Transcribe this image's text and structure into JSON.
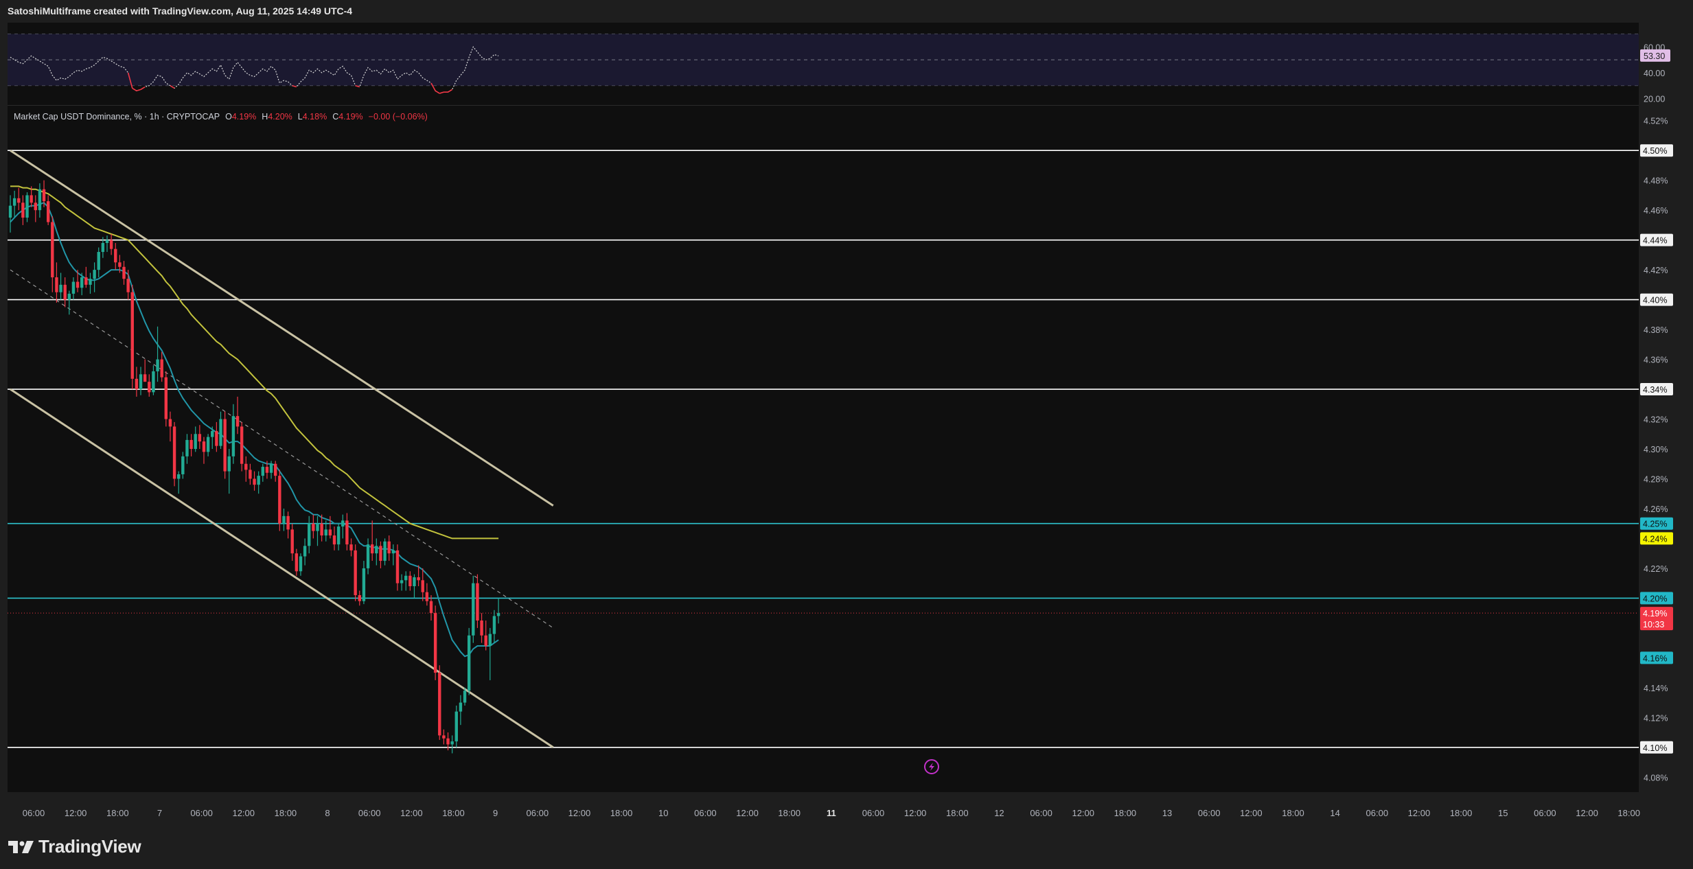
{
  "header": {
    "title": "SatoshiMultiframe created with TradingView.com, Aug 11, 2025 14:49 UTC-4"
  },
  "colors": {
    "background": "#1e1e1e",
    "panel": "#0f0f0f",
    "up": "#22ab94",
    "down": "#f23645",
    "ema_fast": "#2196a8",
    "ema_slow": "#c3c33d",
    "channel": "#c9c2a4",
    "level_white": "#ffffff",
    "level_cyan": "#2ec4cf",
    "rsi_band": "#1b1930"
  },
  "legend": {
    "symbol": "Market Cap USDT Dominance, % · 1h · CRYPTOCAP",
    "o_label": "O",
    "o_value": "4.19%",
    "h_label": "H",
    "h_value": "4.20%",
    "l_label": "L",
    "l_value": "4.18%",
    "c_label": "C",
    "c_value": "4.19%",
    "change": "−0.00 (−0.06%)"
  },
  "rsi_panel": {
    "ticks": [
      "60.00",
      "40.00",
      "20.00"
    ],
    "tick_values": [
      60,
      40,
      20
    ],
    "upper_band": 70,
    "lower_band": 30,
    "current_label": "53.30",
    "current_value": 53.3
  },
  "price_axis": {
    "ticks": [
      "4.52%",
      "4.48%",
      "4.46%",
      "4.42%",
      "4.38%",
      "4.36%",
      "4.32%",
      "4.30%",
      "4.28%",
      "4.26%",
      "4.22%",
      "4.14%",
      "4.12%",
      "4.08%"
    ],
    "tick_values": [
      4.52,
      4.48,
      4.46,
      4.42,
      4.38,
      4.36,
      4.32,
      4.3,
      4.28,
      4.26,
      4.22,
      4.14,
      4.12,
      4.08
    ]
  },
  "levels": [
    {
      "label": "4.50%",
      "value": 4.5,
      "kind": "white"
    },
    {
      "label": "4.44%",
      "value": 4.44,
      "kind": "white"
    },
    {
      "label": "4.40%",
      "value": 4.4,
      "kind": "white"
    },
    {
      "label": "4.34%",
      "value": 4.34,
      "kind": "white"
    },
    {
      "label": "4.25%",
      "value": 4.25,
      "kind": "cyan"
    },
    {
      "label": "4.20%",
      "value": 4.2,
      "kind": "cyan"
    },
    {
      "label": "4.10%",
      "value": 4.1,
      "kind": "white"
    }
  ],
  "badges": {
    "ema_slow": {
      "label": "4.24%",
      "value": 4.24
    },
    "price": {
      "label": "4.19%",
      "value": 4.19,
      "countdown": "10:33"
    },
    "ema_fast": {
      "label": "4.16%",
      "value": 4.16
    }
  },
  "time_axis": {
    "labels": [
      "06:00",
      "12:00",
      "18:00",
      "7",
      "06:00",
      "12:00",
      "18:00",
      "8",
      "06:00",
      "12:00",
      "18:00",
      "9",
      "06:00",
      "12:00",
      "18:00",
      "10",
      "06:00",
      "12:00",
      "18:00",
      "11",
      "06:00",
      "12:00",
      "18:00",
      "12",
      "06:00",
      "12:00",
      "18:00",
      "13",
      "06:00",
      "12:00",
      "18:00",
      "14",
      "06:00",
      "12:00",
      "18:00",
      "15",
      "06:00",
      "12:00",
      "18:00"
    ],
    "bold": [
      "11"
    ]
  },
  "chart_data": {
    "type": "candlestick",
    "symbol": "Market Cap USDT Dominance, %",
    "interval": "1h",
    "exchange": "CRYPTOCAP",
    "unit": "%",
    "ylim": [
      4.07,
      4.53
    ],
    "x_start": "Aug 6 03:00",
    "x_end": "Aug 15 21:00",
    "candles": [
      [
        4.455,
        4.47,
        4.445,
        4.463
      ],
      [
        4.463,
        4.473,
        4.455,
        4.468
      ],
      [
        4.468,
        4.475,
        4.46,
        4.465
      ],
      [
        4.465,
        4.47,
        4.45,
        4.455
      ],
      [
        4.455,
        4.472,
        4.452,
        4.47
      ],
      [
        4.47,
        4.476,
        4.462,
        4.465
      ],
      [
        4.465,
        4.47,
        4.452,
        4.46
      ],
      [
        4.46,
        4.478,
        4.455,
        4.474
      ],
      [
        4.474,
        4.48,
        4.462,
        4.466
      ],
      [
        4.466,
        4.47,
        4.45,
        4.452
      ],
      [
        4.452,
        4.456,
        4.405,
        4.415
      ],
      [
        4.415,
        4.425,
        4.398,
        4.405
      ],
      [
        4.405,
        4.418,
        4.4,
        4.41
      ],
      [
        4.41,
        4.415,
        4.395,
        4.4
      ],
      [
        4.4,
        4.406,
        4.39,
        4.404
      ],
      [
        4.404,
        4.415,
        4.4,
        4.412
      ],
      [
        4.412,
        4.42,
        4.405,
        4.408
      ],
      [
        4.408,
        4.418,
        4.403,
        4.415
      ],
      [
        4.415,
        4.422,
        4.408,
        4.41
      ],
      [
        4.41,
        4.418,
        4.404,
        4.414
      ],
      [
        4.414,
        4.425,
        4.405,
        4.42
      ],
      [
        4.42,
        4.435,
        4.415,
        4.432
      ],
      [
        4.432,
        4.442,
        4.428,
        4.438
      ],
      [
        4.438,
        4.443,
        4.432,
        4.44
      ],
      [
        4.44,
        4.444,
        4.43,
        4.434
      ],
      [
        4.434,
        4.438,
        4.42,
        4.425
      ],
      [
        4.425,
        4.43,
        4.418,
        4.422
      ],
      [
        4.422,
        4.426,
        4.41,
        4.414
      ],
      [
        4.414,
        4.42,
        4.4,
        4.405
      ],
      [
        4.405,
        4.41,
        4.34,
        4.347
      ],
      [
        4.347,
        4.355,
        4.335,
        4.34
      ],
      [
        4.34,
        4.355,
        4.336,
        4.35
      ],
      [
        4.35,
        4.36,
        4.345,
        4.345
      ],
      [
        4.345,
        4.35,
        4.335,
        4.338
      ],
      [
        4.338,
        4.356,
        4.336,
        4.352
      ],
      [
        4.352,
        4.382,
        4.345,
        4.36
      ],
      [
        4.36,
        4.365,
        4.345,
        4.348
      ],
      [
        4.348,
        4.352,
        4.315,
        4.32
      ],
      [
        4.32,
        4.325,
        4.305,
        4.315
      ],
      [
        4.315,
        4.318,
        4.275,
        4.28
      ],
      [
        4.28,
        4.285,
        4.27,
        4.283
      ],
      [
        4.283,
        4.298,
        4.28,
        4.295
      ],
      [
        4.295,
        4.31,
        4.29,
        4.306
      ],
      [
        4.306,
        4.31,
        4.295,
        4.3
      ],
      [
        4.3,
        4.315,
        4.298,
        4.31
      ],
      [
        4.31,
        4.316,
        4.3,
        4.305
      ],
      [
        4.305,
        4.308,
        4.29,
        4.298
      ],
      [
        4.298,
        4.31,
        4.295,
        4.308
      ],
      [
        4.308,
        4.315,
        4.3,
        4.312
      ],
      [
        4.312,
        4.318,
        4.298,
        4.302
      ],
      [
        4.302,
        4.325,
        4.3,
        4.32
      ],
      [
        4.32,
        4.325,
        4.28,
        4.285
      ],
      [
        4.285,
        4.3,
        4.27,
        4.295
      ],
      [
        4.295,
        4.33,
        4.29,
        4.322
      ],
      [
        4.322,
        4.335,
        4.31,
        4.315
      ],
      [
        4.315,
        4.318,
        4.285,
        4.29
      ],
      [
        4.29,
        4.295,
        4.278,
        4.286
      ],
      [
        4.286,
        4.29,
        4.276,
        4.28
      ],
      [
        4.28,
        4.285,
        4.272,
        4.276
      ],
      [
        4.276,
        4.285,
        4.27,
        4.282
      ],
      [
        4.282,
        4.29,
        4.278,
        4.288
      ],
      [
        4.288,
        4.292,
        4.28,
        4.284
      ],
      [
        4.284,
        4.292,
        4.28,
        4.29
      ],
      [
        4.29,
        4.292,
        4.278,
        4.282
      ],
      [
        4.282,
        4.286,
        4.245,
        4.25
      ],
      [
        4.25,
        4.26,
        4.245,
        4.255
      ],
      [
        4.255,
        4.258,
        4.24,
        4.246
      ],
      [
        4.246,
        4.25,
        4.225,
        4.23
      ],
      [
        4.23,
        4.233,
        4.215,
        4.218
      ],
      [
        4.218,
        4.23,
        4.215,
        4.228
      ],
      [
        4.228,
        4.24,
        4.222,
        4.235
      ],
      [
        4.235,
        4.255,
        4.23,
        4.25
      ],
      [
        4.25,
        4.256,
        4.24,
        4.245
      ],
      [
        4.245,
        4.255,
        4.235,
        4.25
      ],
      [
        4.25,
        4.256,
        4.238,
        4.242
      ],
      [
        4.242,
        4.252,
        4.238,
        4.246
      ],
      [
        4.246,
        4.255,
        4.24,
        4.242
      ],
      [
        4.242,
        4.248,
        4.232,
        4.236
      ],
      [
        4.236,
        4.25,
        4.232,
        4.248
      ],
      [
        4.248,
        4.256,
        4.24,
        4.252
      ],
      [
        4.252,
        4.257,
        4.232,
        4.236
      ],
      [
        4.236,
        4.24,
        4.228,
        4.232
      ],
      [
        4.232,
        4.236,
        4.198,
        4.202
      ],
      [
        4.202,
        4.205,
        4.195,
        4.198
      ],
      [
        4.198,
        4.225,
        4.196,
        4.22
      ],
      [
        4.22,
        4.24,
        4.216,
        4.236
      ],
      [
        4.236,
        4.252,
        4.225,
        4.23
      ],
      [
        4.23,
        4.24,
        4.222,
        4.235
      ],
      [
        4.235,
        4.238,
        4.22,
        4.225
      ],
      [
        4.225,
        4.24,
        4.222,
        4.238
      ],
      [
        4.238,
        4.242,
        4.225,
        4.23
      ],
      [
        4.23,
        4.236,
        4.222,
        4.232
      ],
      [
        4.232,
        4.236,
        4.205,
        4.21
      ],
      [
        4.21,
        4.216,
        4.205,
        4.212
      ],
      [
        4.212,
        4.218,
        4.205,
        4.215
      ],
      [
        4.215,
        4.218,
        4.205,
        4.208
      ],
      [
        4.208,
        4.216,
        4.2,
        4.214
      ],
      [
        4.214,
        4.222,
        4.208,
        4.212
      ],
      [
        4.212,
        4.22,
        4.198,
        4.204
      ],
      [
        4.204,
        4.21,
        4.195,
        4.198
      ],
      [
        4.198,
        4.202,
        4.185,
        4.19
      ],
      [
        4.19,
        4.195,
        4.145,
        4.15
      ],
      [
        4.15,
        4.155,
        4.105,
        4.108
      ],
      [
        4.108,
        4.112,
        4.102,
        4.106
      ],
      [
        4.106,
        4.11,
        4.098,
        4.102
      ],
      [
        4.102,
        4.108,
        4.096,
        4.104
      ],
      [
        4.104,
        4.128,
        4.1,
        4.124
      ],
      [
        4.124,
        4.135,
        4.115,
        4.13
      ],
      [
        4.13,
        4.14,
        4.128,
        4.138
      ],
      [
        4.138,
        4.18,
        4.135,
        4.175
      ],
      [
        4.175,
        4.215,
        4.17,
        4.21
      ],
      [
        4.21,
        4.216,
        4.18,
        4.185
      ],
      [
        4.185,
        4.19,
        4.17,
        4.175
      ],
      [
        4.175,
        4.185,
        4.165,
        4.168
      ],
      [
        4.168,
        4.18,
        4.145,
        4.176
      ],
      [
        4.176,
        4.192,
        4.17,
        4.188
      ],
      [
        4.188,
        4.2,
        4.183,
        4.19
      ]
    ],
    "ema_fast_values": [
      4.452,
      4.455,
      4.458,
      4.46,
      4.462,
      4.463,
      4.463,
      4.464,
      4.465,
      4.462,
      4.455,
      4.446,
      4.438,
      4.431,
      4.425,
      4.421,
      4.418,
      4.416,
      4.414,
      4.413,
      4.413,
      4.414,
      4.416,
      4.418,
      4.42,
      4.42,
      4.42,
      4.419,
      4.417,
      4.408,
      4.399,
      4.392,
      4.385,
      4.379,
      4.374,
      4.37,
      4.366,
      4.36,
      4.354,
      4.346,
      4.339,
      4.334,
      4.33,
      4.326,
      4.323,
      4.32,
      4.317,
      4.315,
      4.313,
      4.311,
      4.31,
      4.307,
      4.304,
      4.305,
      4.305,
      4.303,
      4.3,
      4.297,
      4.294,
      4.292,
      4.291,
      4.29,
      4.29,
      4.289,
      4.285,
      4.281,
      4.277,
      4.272,
      4.266,
      4.262,
      4.259,
      4.258,
      4.256,
      4.256,
      4.254,
      4.253,
      4.252,
      4.25,
      4.25,
      4.25,
      4.249,
      4.247,
      4.242,
      4.237,
      4.235,
      4.235,
      4.234,
      4.234,
      4.233,
      4.233,
      4.233,
      4.232,
      4.23,
      4.227,
      4.225,
      4.223,
      4.222,
      4.221,
      4.219,
      4.216,
      4.213,
      4.207,
      4.197,
      4.188,
      4.18,
      4.172,
      4.168,
      4.164,
      4.161,
      4.162,
      4.166,
      4.168,
      4.168,
      4.168,
      4.168,
      4.17,
      4.172
    ],
    "ema_slow_values": [
      4.476,
      4.476,
      4.476,
      4.475,
      4.475,
      4.474,
      4.474,
      4.473,
      4.472,
      4.471,
      4.469,
      4.467,
      4.465,
      4.462,
      4.46,
      4.458,
      4.456,
      4.454,
      4.452,
      4.45,
      4.448,
      4.447,
      4.446,
      4.445,
      4.444,
      4.443,
      4.442,
      4.441,
      4.44,
      4.437,
      4.434,
      4.431,
      4.428,
      4.425,
      4.422,
      4.419,
      4.416,
      4.412,
      4.409,
      4.405,
      4.401,
      4.397,
      4.394,
      4.39,
      4.387,
      4.384,
      4.381,
      4.378,
      4.375,
      4.372,
      4.37,
      4.367,
      4.364,
      4.362,
      4.36,
      4.357,
      4.354,
      4.351,
      4.348,
      4.345,
      4.342,
      4.339,
      4.337,
      4.334,
      4.33,
      4.326,
      4.322,
      4.318,
      4.314,
      4.311,
      4.308,
      4.305,
      4.302,
      4.299,
      4.297,
      4.294,
      4.292,
      4.289,
      4.287,
      4.285,
      4.283,
      4.28,
      4.277,
      4.274,
      4.272,
      4.27,
      4.268,
      4.266,
      4.264,
      4.262,
      4.26,
      4.258,
      4.256,
      4.254,
      4.252,
      4.25,
      4.249,
      4.248,
      4.247,
      4.246,
      4.245,
      4.244,
      4.243,
      4.242,
      4.241,
      4.24,
      4.24,
      4.24,
      4.24,
      4.24,
      4.24,
      4.24,
      4.24,
      4.24,
      4.24,
      4.24,
      4.24
    ],
    "channel_upper": [
      {
        "x": 0,
        "y": 4.5
      },
      {
        "x": 129,
        "y": 4.262
      }
    ],
    "channel_lower": [
      {
        "x": 0,
        "y": 4.34
      },
      {
        "x": 129,
        "y": 4.1
      }
    ],
    "channel_mid": [
      {
        "x": 0,
        "y": 4.42
      },
      {
        "x": 129,
        "y": 4.18
      }
    ],
    "rsi_values": [
      52,
      50,
      48,
      47,
      50,
      53,
      51,
      49,
      47,
      45,
      38,
      34,
      36,
      35,
      37,
      40,
      42,
      41,
      43,
      44,
      46,
      49,
      52,
      51,
      49,
      47,
      45,
      44,
      40,
      28,
      26,
      27,
      29,
      30,
      33,
      38,
      37,
      32,
      30,
      28,
      31,
      36,
      40,
      38,
      41,
      39,
      37,
      40,
      43,
      41,
      46,
      38,
      35,
      44,
      48,
      44,
      40,
      38,
      37,
      40,
      43,
      41,
      45,
      42,
      32,
      34,
      33,
      30,
      29,
      33,
      36,
      42,
      40,
      43,
      40,
      42,
      40,
      38,
      43,
      45,
      40,
      38,
      30,
      29,
      38,
      44,
      41,
      42,
      39,
      43,
      40,
      42,
      35,
      38,
      40,
      38,
      42,
      40,
      36,
      34,
      32,
      26,
      24,
      25,
      25,
      27,
      34,
      38,
      42,
      52,
      60,
      56,
      52,
      50,
      51,
      54,
      53
    ]
  }
}
